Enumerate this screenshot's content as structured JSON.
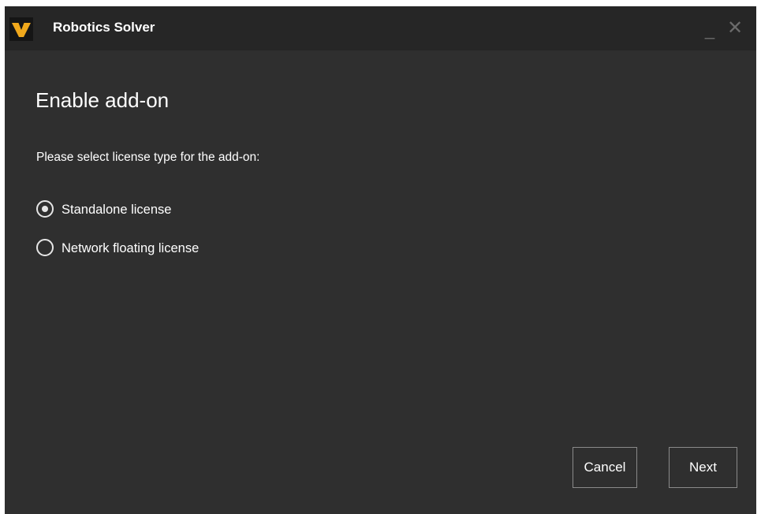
{
  "window": {
    "title": "Robotics Solver",
    "minimize_glyph": "_",
    "close_glyph": "✕"
  },
  "icons": {
    "app_logo": "app-logo-icon",
    "minimize": "minimize-icon",
    "close": "close-icon"
  },
  "content": {
    "heading": "Enable add-on",
    "prompt": "Please select license type for the add-on:",
    "license_options": [
      {
        "label": "Standalone license",
        "selected": true
      },
      {
        "label": "Network floating license",
        "selected": false
      }
    ]
  },
  "footer": {
    "cancel_label": "Cancel",
    "next_label": "Next"
  },
  "colors": {
    "window_background": "#2f2f2f",
    "titlebar_background": "#262626",
    "logo_accent": "#f0a81c",
    "text": "#ffffff",
    "button_border": "#8a8a8a"
  }
}
